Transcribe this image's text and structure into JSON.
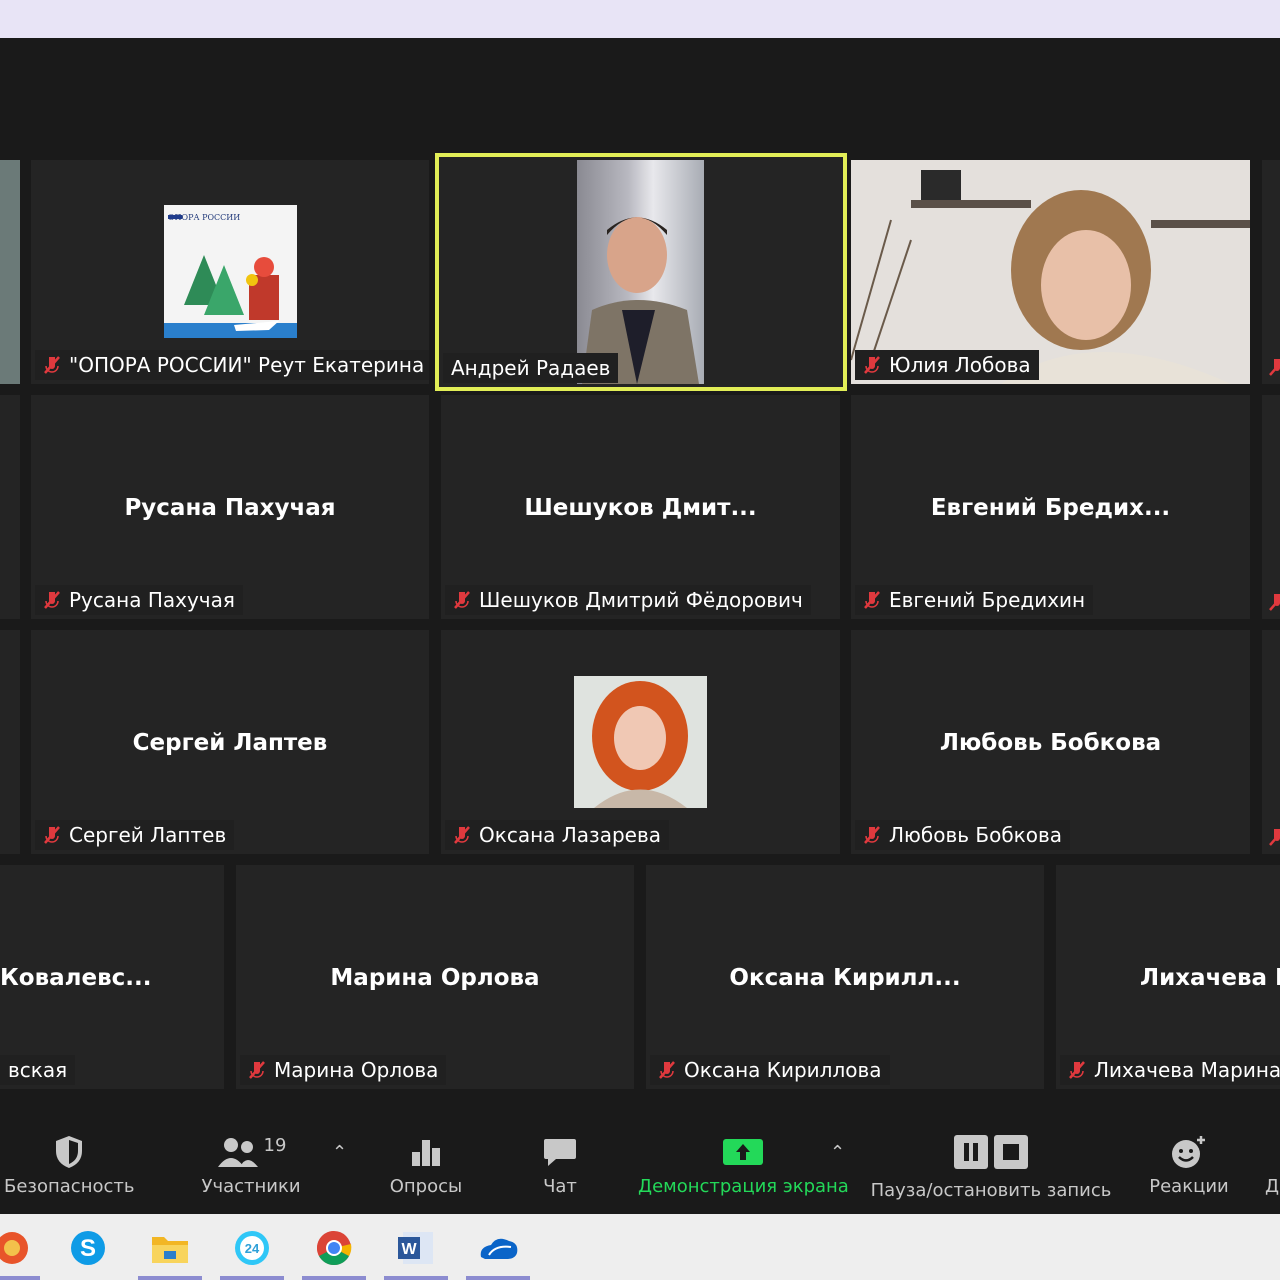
{
  "tiles": {
    "opora": {
      "label": "\"ОПОРА РОССИИ\" Реут Екатерина",
      "logo_text": "ОПОРА РОССИИ"
    },
    "radaev": {
      "label": "Андрей Радаев"
    },
    "lobova": {
      "label": "Юлия Лобова"
    },
    "rusana": {
      "big": "Русана Пахучая",
      "label": "Русана Пахучая"
    },
    "sheshukov": {
      "big": "Шешуков Дмит...",
      "label": "Шешуков Дмитрий Фёдорович"
    },
    "bredikhin": {
      "big": "Евгений Бредих...",
      "label": "Евгений Бредихин"
    },
    "laptev": {
      "big": "Сергей Лаптев",
      "label": "Сергей Лаптев"
    },
    "lazareva": {
      "label": "Оксана Лазарева"
    },
    "bobkova": {
      "big": "Любовь Бобкова",
      "label": "Любовь Бобкова"
    },
    "kovalevskaya": {
      "big": "Ковалевс...",
      "label": "вская"
    },
    "orlova": {
      "big": "Марина Орлова",
      "label": "Марина Орлова"
    },
    "kirillova": {
      "big": "Оксана Кирилл...",
      "label": "Оксана Кириллова"
    },
    "likhacheva": {
      "big": "Лихачева М",
      "label": "Лихачева Марина"
    }
  },
  "toolbar": {
    "security": "Безопасность",
    "participants": "Участники",
    "participants_count": "19",
    "polls": "Опросы",
    "chat": "Чат",
    "share": "Демонстрация экрана",
    "record": "Пауза/остановить запись",
    "reactions": "Реакции",
    "more": "Д"
  },
  "colors": {
    "active_speaker": "#e2ee57",
    "share_green": "#23d959",
    "muted_red": "#e0393e"
  },
  "taskbar_icons": [
    "browser-icon",
    "skype-icon",
    "file-explorer-icon",
    "bitrix24-icon",
    "chrome-icon",
    "word-icon",
    "onedrive-icon"
  ]
}
